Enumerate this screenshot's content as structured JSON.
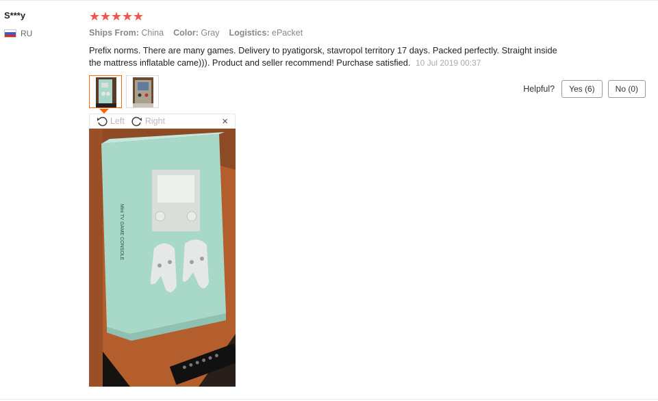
{
  "review": {
    "user": "S***y",
    "country": "RU",
    "rating": 5,
    "meta": [
      {
        "label": "Ships From:",
        "value": "China"
      },
      {
        "label": "Color:",
        "value": "Gray"
      },
      {
        "label": "Logistics:",
        "value": "ePacket"
      }
    ],
    "text": "Prefix norms. There are many games. Delivery to pyatigorsk, stavropol territory 17 days. Packed perfectly. Straight inside the mattress inflatable came))). Product and seller recommend! Purchase satisfied.",
    "date": "10 Jul 2019 00:37",
    "helpful": {
      "label": "Helpful?",
      "yes": "Yes (6)",
      "no": "No (0)"
    },
    "viewer": {
      "left": "Left",
      "right": "Right",
      "close": "×"
    },
    "photo_box_text": "Mini TV GAME CONSOLE"
  },
  "colors": {
    "star": "#f3534a",
    "active_thumb": "#ff6600",
    "box": "#a7d8c8",
    "table": "#b45d2d"
  },
  "icons": [
    "star-icon",
    "rotate-left-icon",
    "rotate-right-icon",
    "close-icon",
    "flag-ru-icon"
  ]
}
